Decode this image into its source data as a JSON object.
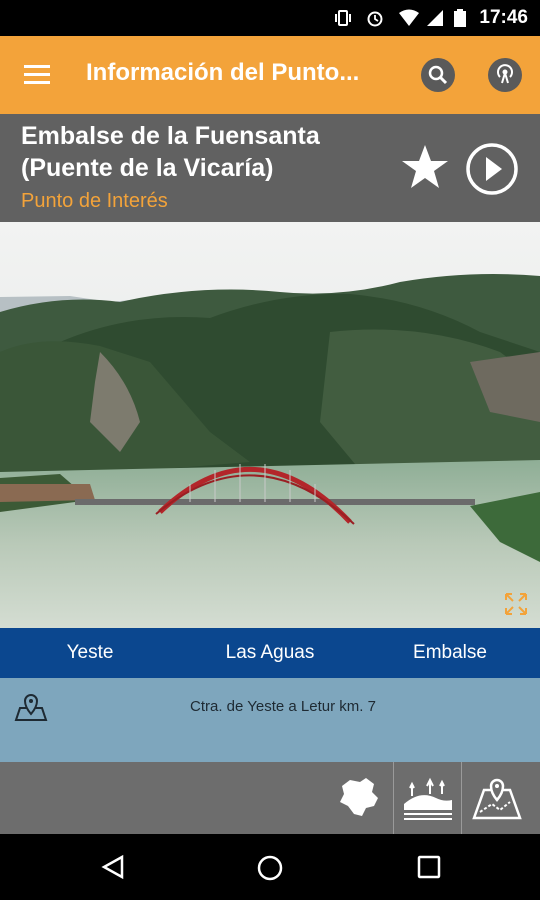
{
  "status_bar": {
    "time": "17:46"
  },
  "app_bar": {
    "title": "Información del Punto..."
  },
  "point": {
    "name_line1": "Embalse de la Fuensanta",
    "name_line2": "(Puente de la Vicaría)",
    "type": "Punto de Interés"
  },
  "tabs": [
    {
      "label": "Yeste"
    },
    {
      "label": "Las Aguas"
    },
    {
      "label": "Embalse"
    }
  ],
  "address": {
    "text": "Ctra. de Yeste a Letur km. 7"
  },
  "colors": {
    "accent": "#f3a33a",
    "tab_bar": "#0b478f",
    "header": "#616161"
  }
}
